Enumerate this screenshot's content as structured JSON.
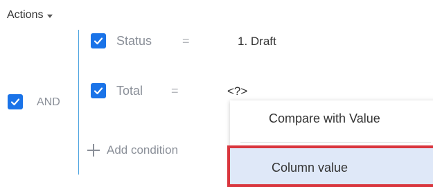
{
  "actions_menu": {
    "label": "Actions"
  },
  "group": {
    "operator_label": "AND",
    "conditions": [
      {
        "field": "Status",
        "operator": "=",
        "value": "1. Draft",
        "checked": true
      },
      {
        "field": "Total",
        "operator": "=",
        "value": "<?>",
        "checked": true
      }
    ],
    "add_condition_label": "Add condition"
  },
  "value_menu": {
    "items": [
      {
        "label": "Compare with Value"
      },
      {
        "label": "Column value",
        "highlighted": true
      }
    ]
  },
  "colors": {
    "checkbox": "#1a73e8",
    "group_line": "#4aa3df",
    "highlight_bg": "#dfe8f8",
    "highlight_border": "#d9363e"
  }
}
